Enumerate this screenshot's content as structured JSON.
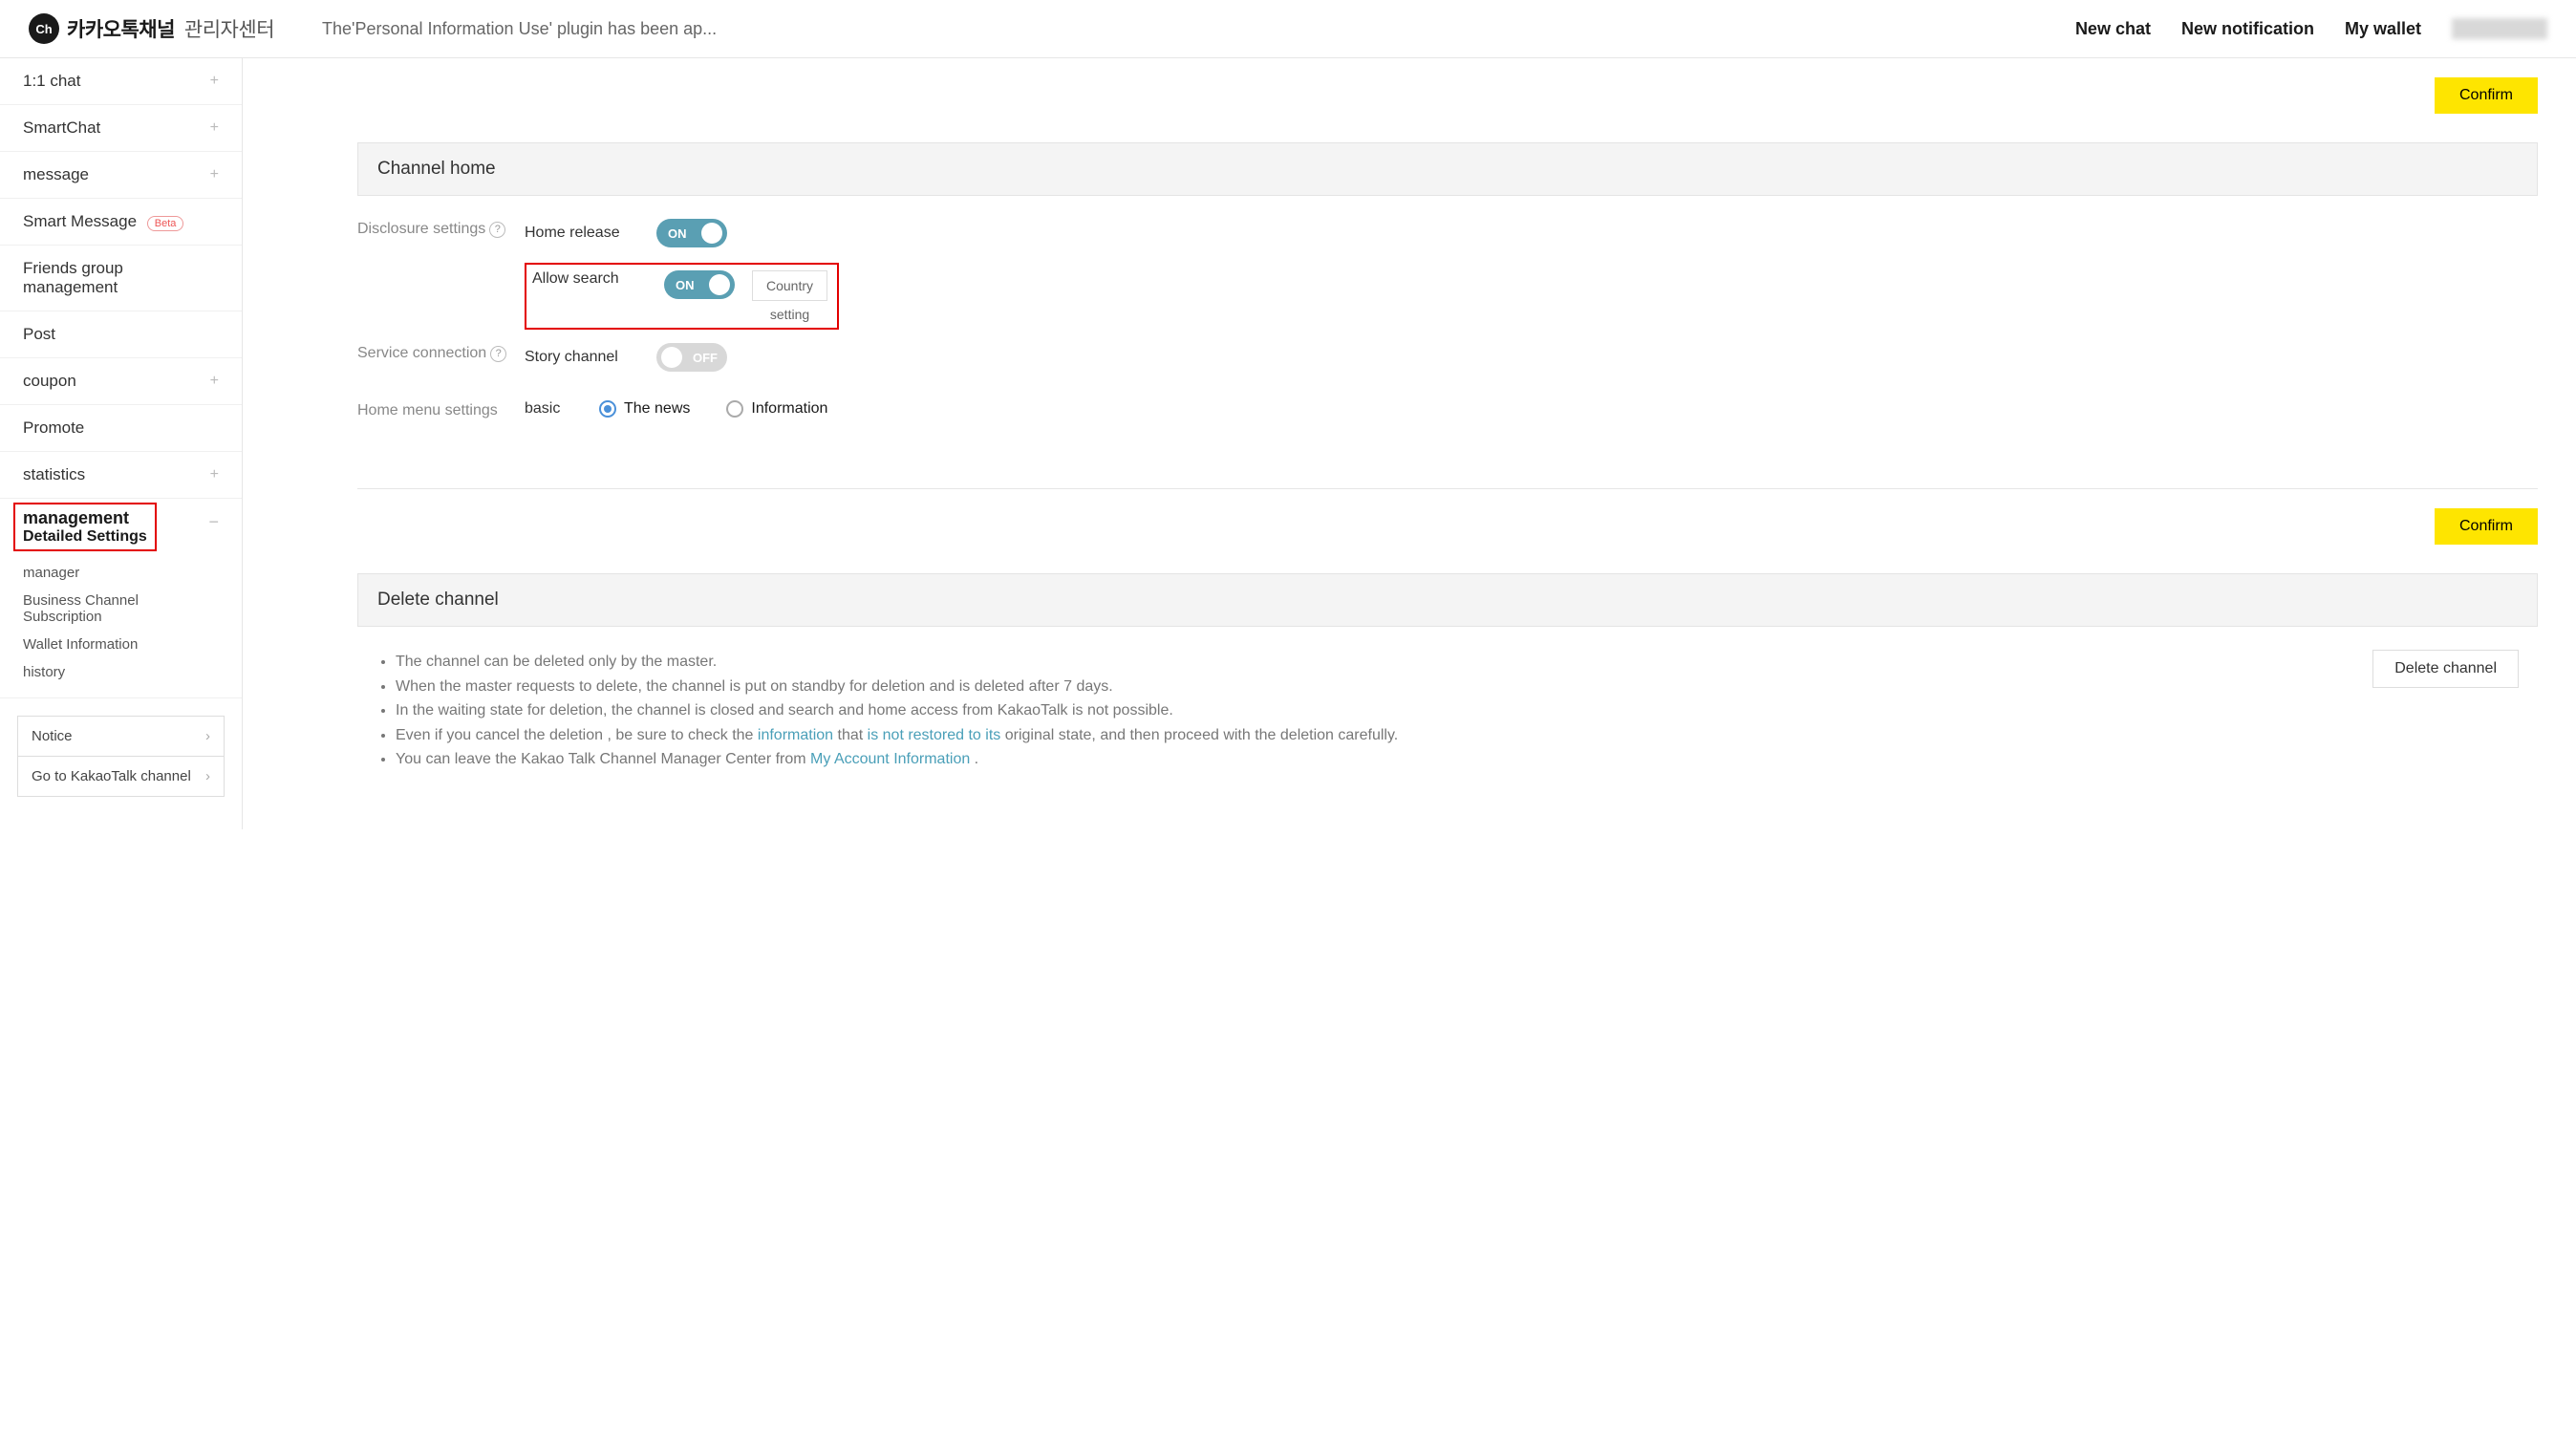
{
  "header": {
    "logo_icon": "Ch",
    "logo_main": "카카오톡채널",
    "logo_sub": "관리자센터",
    "breadcrumb": "The'Personal Information Use' plugin has been ap...",
    "links": {
      "new_chat": "New chat",
      "new_notification": "New notification",
      "my_wallet": "My wallet"
    }
  },
  "sidebar": {
    "items": [
      {
        "label": "1:1 chat",
        "expandable": true
      },
      {
        "label": "SmartChat",
        "expandable": true
      },
      {
        "label": "message",
        "expandable": true
      },
      {
        "label": "Smart Message",
        "beta": "Beta"
      },
      {
        "label": "Friends group management"
      },
      {
        "label": "Post"
      },
      {
        "label": "coupon",
        "expandable": true
      },
      {
        "label": "Promote"
      },
      {
        "label": "statistics",
        "expandable": true
      }
    ],
    "management": {
      "title": "management",
      "sub": [
        {
          "label": "Detailed Settings",
          "active": true
        },
        {
          "label": "manager"
        },
        {
          "label": "Business Channel Subscription"
        },
        {
          "label": "Wallet Information"
        },
        {
          "label": "history"
        }
      ]
    },
    "bottom": {
      "notice": "Notice",
      "goto": "Go to KakaoTalk channel"
    }
  },
  "main": {
    "confirm": "Confirm",
    "channel_home": {
      "title": "Channel home",
      "disclosure_label": "Disclosure settings",
      "home_release": {
        "label": "Home release",
        "state": "ON"
      },
      "allow_search": {
        "label": "Allow search",
        "state": "ON",
        "country_btn": "Country",
        "country_caption": "setting"
      },
      "service_label": "Service connection",
      "story_channel": {
        "label": "Story channel",
        "state": "OFF"
      },
      "home_menu_label": "Home menu settings",
      "home_menu_value": "basic",
      "radio_news": "The news",
      "radio_info": "Information"
    },
    "delete": {
      "title": "Delete channel",
      "bullets": [
        "The channel can be deleted only by the master.",
        "When the master requests to delete, the channel is put on standby for deletion and is deleted after 7 days.",
        "In the waiting state for deletion, the channel is closed and search and home access from KakaoTalk is not possible.",
        "Even if you cancel the deletion , be sure to check the ",
        " that ",
        " original state, and then proceed with the deletion carefully.",
        "You can leave the Kakao Talk Channel Manager Center from ",
        " ."
      ],
      "link_information": "information",
      "link_not_restored": "is not restored to its",
      "link_my_account": "My Account Information",
      "btn": "Delete channel"
    }
  }
}
